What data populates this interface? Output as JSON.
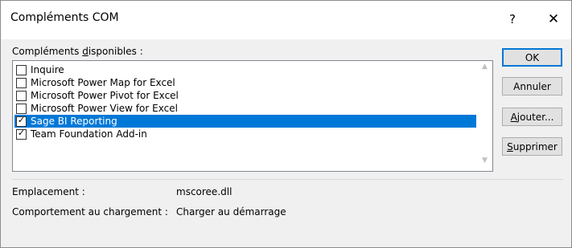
{
  "dialog": {
    "title": "Compléments COM",
    "help_glyph": "?",
    "close_glyph": "✕"
  },
  "list": {
    "label_prefix": "Compléments ",
    "label_accel": "d",
    "label_suffix": "isponibles :",
    "items": [
      {
        "label": "Inquire",
        "checked": false,
        "selected": false
      },
      {
        "label": "Microsoft Power Map for Excel",
        "checked": false,
        "selected": false
      },
      {
        "label": "Microsoft Power Pivot for Excel",
        "checked": false,
        "selected": false
      },
      {
        "label": "Microsoft Power View for Excel",
        "checked": false,
        "selected": false
      },
      {
        "label": "Sage BI Reporting",
        "checked": true,
        "selected": true
      },
      {
        "label": "Team Foundation Add-in",
        "checked": true,
        "selected": false
      }
    ]
  },
  "buttons": {
    "ok": "OK",
    "cancel": "Annuler",
    "add_accel": "A",
    "add_rest": "jouter...",
    "remove_accel": "S",
    "remove_rest": "upprimer"
  },
  "info": {
    "location_label": "Emplacement :",
    "location_value": "mscoree.dll",
    "load_label": "Comportement au chargement :",
    "load_value": "Charger au démarrage"
  },
  "colors": {
    "selection": "#0078d7",
    "dialog_bg": "#f0f0f0"
  },
  "icons": {
    "scroll_up": "chevron-up-icon",
    "scroll_down": "chevron-down-icon",
    "check": "checkmark-icon"
  }
}
